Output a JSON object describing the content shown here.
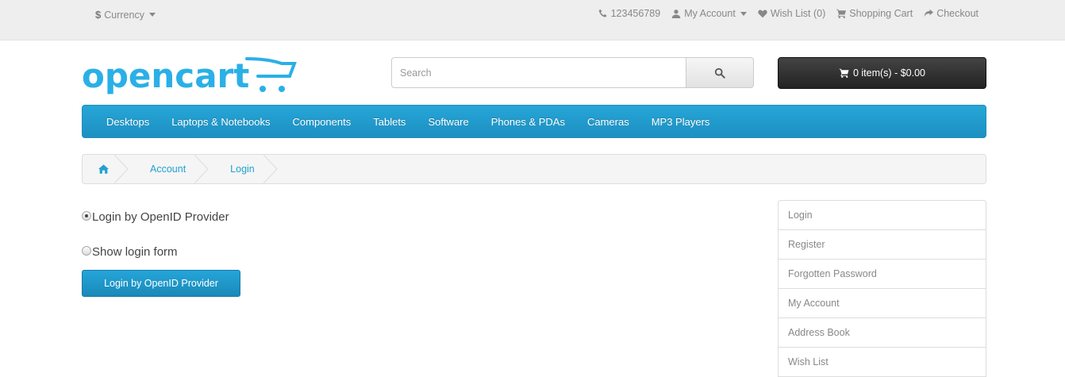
{
  "topbar": {
    "currency_symbol": "$",
    "currency_label": "Currency",
    "phone": "123456789",
    "my_account": "My Account",
    "wish_list": "Wish List (0)",
    "shopping_cart": "Shopping Cart",
    "checkout": "Checkout"
  },
  "header": {
    "logo_text": "opencart",
    "search_placeholder": "Search",
    "cart_label": "0 item(s) - $0.00"
  },
  "menu": {
    "items": [
      "Desktops",
      "Laptops & Notebooks",
      "Components",
      "Tablets",
      "Software",
      "Phones & PDAs",
      "Cameras",
      "MP3 Players"
    ]
  },
  "breadcrumb": {
    "items": [
      "Account",
      "Login"
    ]
  },
  "content": {
    "radio_openid": "Login by OpenID Provider",
    "radio_form": "Show login form",
    "openid_button": "Login by OpenID Provider"
  },
  "sidebar": {
    "items": [
      "Login",
      "Register",
      "Forgotten Password",
      "My Account",
      "Address Book",
      "Wish List"
    ]
  },
  "colors": {
    "accent": "#229ac8",
    "logo": "#2ab0e6",
    "cart_bg": "#303030"
  }
}
